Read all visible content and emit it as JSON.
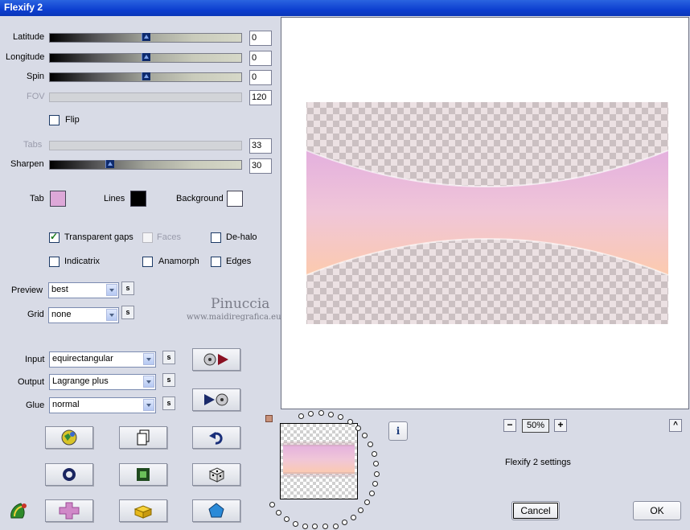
{
  "window": {
    "title": "Flexify 2"
  },
  "sliders": {
    "latitude": {
      "label": "Latitude",
      "value": "0"
    },
    "longitude": {
      "label": "Longitude",
      "value": "0"
    },
    "spin": {
      "label": "Spin",
      "value": "0"
    },
    "fov": {
      "label": "FOV",
      "value": "120"
    },
    "tabs": {
      "label": "Tabs",
      "value": "33"
    },
    "sharpen": {
      "label": "Sharpen",
      "value": "30"
    }
  },
  "flip": {
    "label": "Flip",
    "checked": false
  },
  "colors": {
    "tab": {
      "label": "Tab",
      "color": "#dda8d8"
    },
    "lines": {
      "label": "Lines",
      "color": "#000000"
    },
    "background": {
      "label": "Background",
      "color": "#ffffff"
    }
  },
  "options": {
    "transparent_gaps": {
      "label": "Transparent gaps",
      "checked": true
    },
    "faces": {
      "label": "Faces",
      "checked": false
    },
    "de_halo": {
      "label": "De-halo",
      "checked": false
    },
    "indicatrix": {
      "label": "Indicatrix",
      "checked": false
    },
    "anamorph": {
      "label": "Anamorph",
      "checked": false
    },
    "edges": {
      "label": "Edges",
      "checked": false
    }
  },
  "selects": {
    "preview": {
      "label": "Preview",
      "value": "best"
    },
    "grid": {
      "label": "Grid",
      "value": "none"
    },
    "input": {
      "label": "Input",
      "value": "equirectangular"
    },
    "output": {
      "label": "Output",
      "value": "Lagrange plus"
    },
    "glue": {
      "label": "Glue",
      "value": "normal"
    }
  },
  "s_button_label": "s",
  "watermark": {
    "name": "Pinuccia",
    "url": "www.maidiregrafica.eu"
  },
  "zoom": {
    "value": "50%",
    "minus": "−",
    "plus": "+"
  },
  "info_icon": "i",
  "collapse_label": "^",
  "status": "Flexify 2 settings",
  "buttons": {
    "cancel": "Cancel",
    "ok": "OK"
  },
  "icons": [
    "input-to-output-icon",
    "output-to-input-icon",
    "globe-icon",
    "copy-icon",
    "undo-icon",
    "ring-icon",
    "frame-icon",
    "dice-icon",
    "cross-icon",
    "lego-brick-icon",
    "pentagon-icon",
    "plugin-logo-icon"
  ]
}
